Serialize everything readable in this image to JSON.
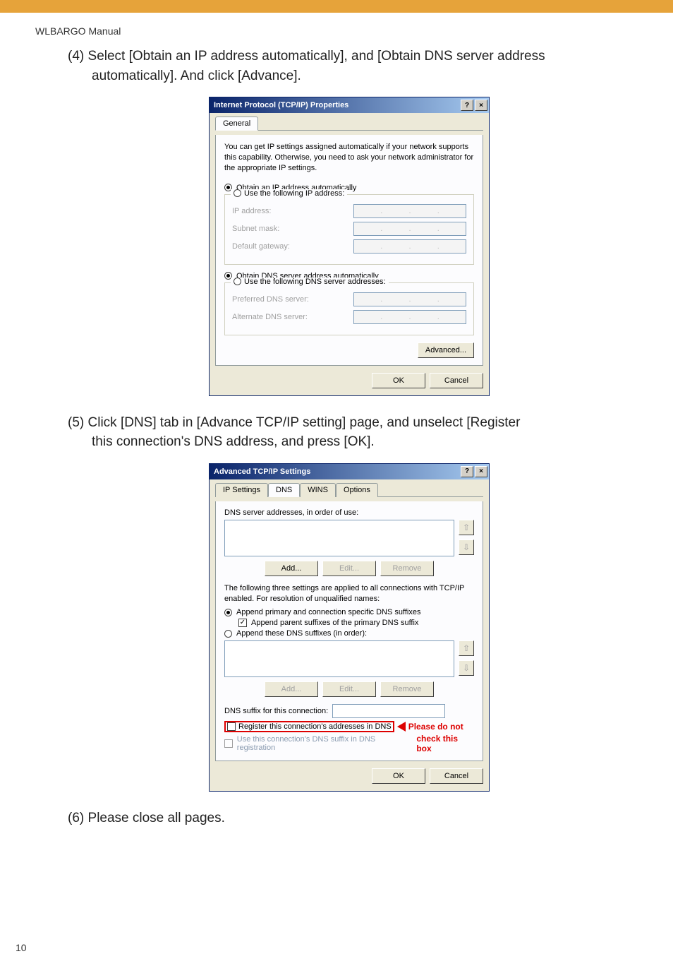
{
  "header": {
    "label": "WLBARGO Manual"
  },
  "steps": {
    "s4": {
      "num": "(4)",
      "text1": "Select [Obtain an IP address automatically], and [Obtain DNS server address",
      "text2": "automatically]. And click [Advance]."
    },
    "s5": {
      "num": "(5)",
      "text1": "Click [DNS] tab in [Advance TCP/IP setting] page, and unselect [Register",
      "text2": "this connection's DNS address, and press [OK]."
    },
    "s6": {
      "num": "(6)",
      "text": "Please close all pages."
    }
  },
  "dlg1": {
    "title": "Internet Protocol (TCP/IP) Properties",
    "help": "?",
    "close": "×",
    "tab_general": "General",
    "intro": "You can get IP settings assigned automatically if your network supports this capability. Otherwise, you need to ask your network administrator for the appropriate IP settings.",
    "r_auto_ip": "Obtain an IP address automatically",
    "r_man_ip": "Use the following IP address:",
    "lbl_ip": "IP address:",
    "lbl_mask": "Subnet mask:",
    "lbl_gw": "Default gateway:",
    "r_auto_dns": "Obtain DNS server address automatically",
    "r_man_dns": "Use the following DNS server addresses:",
    "lbl_pdns": "Preferred DNS server:",
    "lbl_adns": "Alternate DNS server:",
    "btn_adv": "Advanced...",
    "btn_ok": "OK",
    "btn_cancel": "Cancel"
  },
  "dlg2": {
    "title": "Advanced TCP/IP Settings",
    "help": "?",
    "close": "×",
    "tabs": {
      "ip": "IP Settings",
      "dns": "DNS",
      "wins": "WINS",
      "opt": "Options"
    },
    "lbl_dns_order": "DNS server addresses, in order of use:",
    "btn_add": "Add...",
    "btn_edit": "Edit...",
    "btn_remove": "Remove",
    "lbl_three": "The following three settings are applied to all connections with TCP/IP enabled. For resolution of unqualified names:",
    "r_append_prim": "Append primary and connection specific DNS suffixes",
    "chk_append_parent": "Append parent suffixes of the primary DNS suffix",
    "r_append_these": "Append these DNS suffixes (in order):",
    "lbl_suffix": "DNS suffix for this connection:",
    "chk_register": "Register this connection's addresses in DNS",
    "chk_use_suffix": "Use this connection's DNS suffix in DNS registration",
    "btn_ok": "OK",
    "btn_cancel": "Cancel",
    "annot1": "Please do not",
    "annot2": "check this box"
  },
  "footer": {
    "page": "10"
  }
}
